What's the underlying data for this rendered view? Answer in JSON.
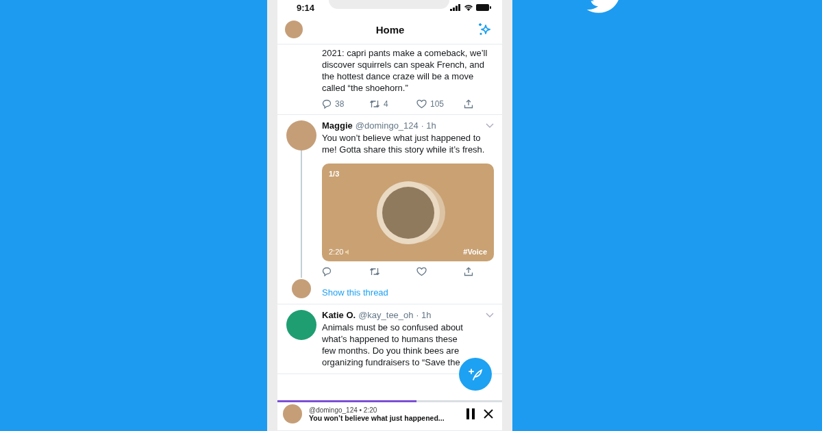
{
  "status_bar": {
    "time": "9:14"
  },
  "header": {
    "title": "Home"
  },
  "tweets": [
    {
      "kind": "partial",
      "text": "2021: capri pants make a comeback, we’ll discover squirrels can speak French, and the hottest dance craze will be a move called “the shoehorn.”",
      "actions": [
        {
          "kind": "reply",
          "count": "38"
        },
        {
          "kind": "retweet",
          "count": "4"
        },
        {
          "kind": "like",
          "count": "105"
        },
        {
          "kind": "share"
        }
      ]
    },
    {
      "kind": "voice",
      "name": "Maggie",
      "meta": "@domingo_124 · 1h",
      "text": "You won’t believe what just happened to me! Gotta share this story while it’s fresh.",
      "voice": {
        "counter": "1/3",
        "duration": "2:20",
        "hashtag": "#Voice"
      },
      "actions": [
        {
          "kind": "reply"
        },
        {
          "kind": "retweet"
        },
        {
          "kind": "like"
        },
        {
          "kind": "share"
        }
      ],
      "thread_link": "Show this thread"
    },
    {
      "kind": "text",
      "name": "Katie O.",
      "meta": "@kay_tee_oh · 1h",
      "text": "Animals must be so confused about what’s happened to humans these few months. Do you think bees are organizing fundraisers to “Save the"
    }
  ],
  "player": {
    "meta": "@domingo_124 • 2:20",
    "title": "You won’t believe what just happened...",
    "level": 0.62
  }
}
